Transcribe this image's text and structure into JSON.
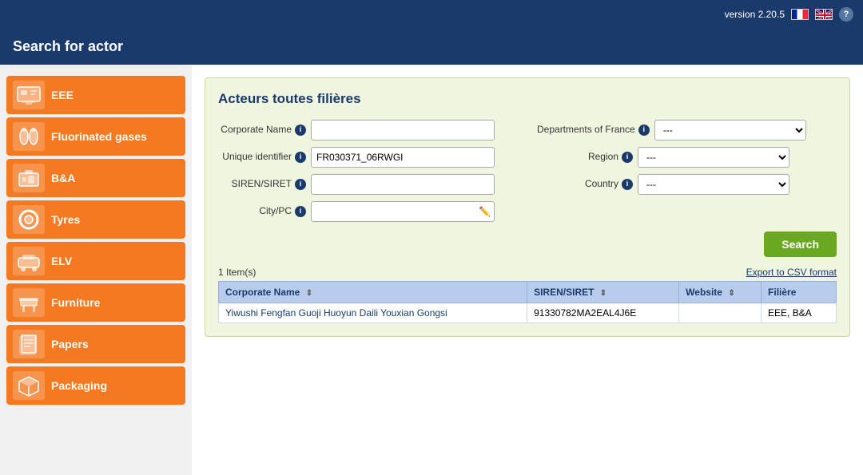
{
  "topbar": {
    "version": "version 2.20.5",
    "help_label": "?"
  },
  "header": {
    "title": "Search for actor"
  },
  "sidebar": {
    "items": [
      {
        "id": "eee",
        "label": "EEE",
        "icon": "🖨"
      },
      {
        "id": "fluorinated",
        "label": "Fluorinated gases",
        "icon": "🔴"
      },
      {
        "id": "ba",
        "label": "B&A",
        "icon": "🔋"
      },
      {
        "id": "tyres",
        "label": "Tyres",
        "icon": "⭕"
      },
      {
        "id": "elv",
        "label": "ELV",
        "icon": "🚗"
      },
      {
        "id": "furniture",
        "label": "Furniture",
        "icon": "🪑"
      },
      {
        "id": "papers",
        "label": "Papers",
        "icon": "📄"
      },
      {
        "id": "packaging",
        "label": "Packaging",
        "icon": "📦"
      }
    ]
  },
  "panel": {
    "title": "Acteurs toutes filières"
  },
  "form": {
    "corporate_name_label": "Corporate Name",
    "corporate_name_value": "",
    "corporate_name_placeholder": "",
    "unique_id_label": "Unique identifier",
    "unique_id_value": "FR030371_06RWGI",
    "siren_label": "SIREN/SIRET",
    "siren_value": "",
    "city_label": "City/PC",
    "city_value": "",
    "dept_france_label": "Departments of France",
    "dept_france_value": "---",
    "region_label": "Region",
    "region_value": "---",
    "country_label": "Country",
    "country_value": "---",
    "dept_options": [
      "---"
    ],
    "region_options": [
      "---"
    ],
    "country_options": [
      "---"
    ],
    "search_button": "Search",
    "export_link": "Export to CSV format"
  },
  "results": {
    "count_label": "1 Item(s)",
    "columns": [
      {
        "key": "corporate_name",
        "label": "Corporate Name"
      },
      {
        "key": "siren",
        "label": "SIREN/SIRET"
      },
      {
        "key": "website",
        "label": "Website"
      },
      {
        "key": "filiere",
        "label": "Filière"
      }
    ],
    "rows": [
      {
        "corporate_name": "Yiwushi Fengfan Guoji Huoyun Daili Youxian Gongsi",
        "siren": "91330782MA2EAL4J6E",
        "website": "",
        "filiere": "EEE, B&A"
      }
    ]
  }
}
